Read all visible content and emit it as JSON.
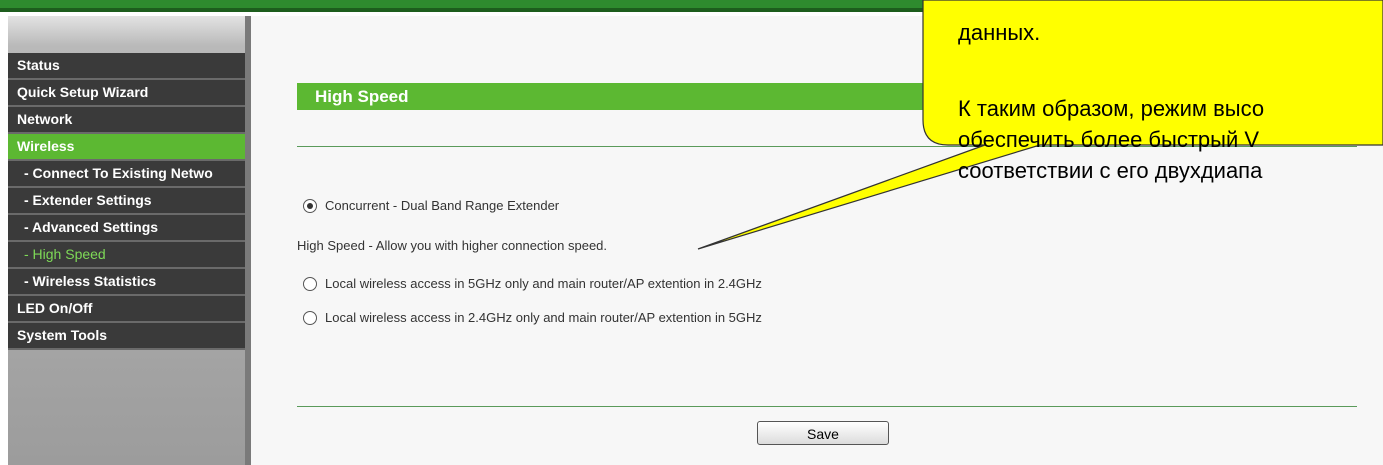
{
  "sidebar": {
    "items": [
      {
        "label": "Status"
      },
      {
        "label": "Quick Setup Wizard"
      },
      {
        "label": "Network"
      },
      {
        "label": "Wireless"
      },
      {
        "label": "- Connect To Existing Netwo"
      },
      {
        "label": "- Extender Settings"
      },
      {
        "label": "- Advanced Settings"
      },
      {
        "label": "- High Speed"
      },
      {
        "label": "- Wireless Statistics"
      },
      {
        "label": "LED On/Off"
      },
      {
        "label": "System Tools"
      }
    ]
  },
  "main": {
    "title": "High Speed",
    "mode_option": "Concurrent - Dual Band Range Extender",
    "description": "High Speed - Allow you with higher connection speed.",
    "options": [
      "Local wireless access in 5GHz only and main router/AP extention in 2.4GHz",
      "Local wireless access in 2.4GHz only and main router/AP extention in 5GHz"
    ],
    "save_label": "Save"
  },
  "callout": {
    "lines": [
      "данных.",
      "К таким образом, режим высо",
      "обеспечить более быстрый V",
      "соответствии с его двухдиапа"
    ]
  },
  "colors": {
    "accent_green": "#5cb832",
    "menu_dark": "#3a3a3a",
    "callout_fill": "#ffff00",
    "active_sub_text": "#7ed957"
  }
}
